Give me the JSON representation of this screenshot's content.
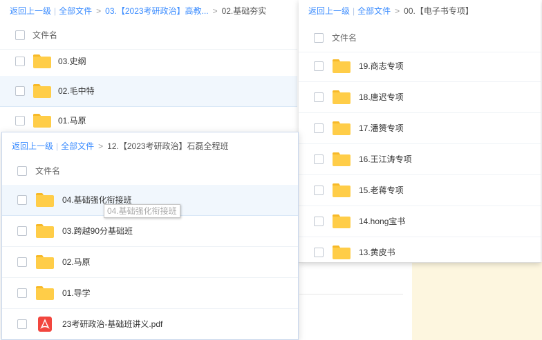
{
  "panel_a": {
    "breadcrumb": {
      "back": "返回上一级",
      "all": "全部文件",
      "mid": "03.【2023考研政治】高教...",
      "current": "02.基础夯实"
    },
    "column_header": "文件名",
    "rows": [
      {
        "name": "03.史纲",
        "icon": "folder-icon"
      },
      {
        "name": "02.毛中特",
        "icon": "folder-icon"
      },
      {
        "name": "01.马原",
        "icon": "folder-icon"
      }
    ]
  },
  "panel_b": {
    "breadcrumb": {
      "back": "返回上一级",
      "all": "全部文件",
      "current": "00.【电子书专项】"
    },
    "column_header": "文件名",
    "rows": [
      {
        "name": "19.商志专项",
        "icon": "folder-icon"
      },
      {
        "name": "18.唐迟专项",
        "icon": "folder-icon"
      },
      {
        "name": "17.潘赟专项",
        "icon": "folder-icon"
      },
      {
        "name": "16.王江涛专项",
        "icon": "folder-icon"
      },
      {
        "name": "15.老蒋专项",
        "icon": "folder-icon"
      },
      {
        "name": "14.hong宝书",
        "icon": "folder-icon"
      },
      {
        "name": "13.黄皮书",
        "icon": "folder-icon"
      }
    ]
  },
  "panel_c": {
    "breadcrumb": {
      "back": "返回上一级",
      "all": "全部文件",
      "current": "12.【2023考研政治】石磊全程班"
    },
    "column_header": "文件名",
    "rows": [
      {
        "name": "04.基础强化衔接班",
        "icon": "folder-icon"
      },
      {
        "name": "03.跨越90分基础班",
        "icon": "folder-icon"
      },
      {
        "name": "02.马原",
        "icon": "folder-icon"
      },
      {
        "name": "01.导学",
        "icon": "folder-icon"
      },
      {
        "name": "23考研政治-基础班讲义.pdf",
        "icon": "pdf-icon"
      }
    ]
  },
  "drag_ghost": "04.基础强化衔接班",
  "colors": {
    "link": "#3b8cff",
    "folder": "#ffcd48",
    "folder_tab": "#f7b928",
    "pdf": "#f2463e",
    "selected_row": "#f1f7fd"
  }
}
